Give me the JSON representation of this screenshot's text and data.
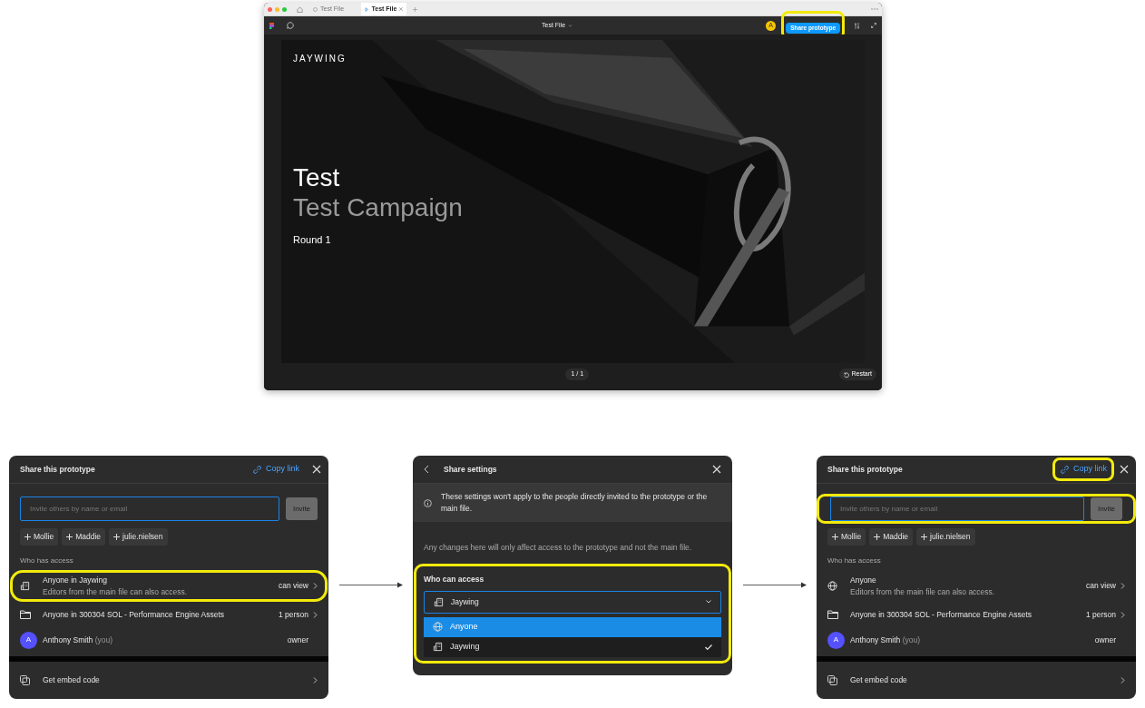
{
  "browser": {
    "tabs": [
      {
        "label": "Test File",
        "kind": "file",
        "selected": false
      },
      {
        "label": "Test File",
        "kind": "prototype",
        "selected": true
      }
    ],
    "toolbar": {
      "file_title": "Test File",
      "avatar": "A",
      "share_button": {
        "label": "Share prototype",
        "highlighted": true
      }
    },
    "slide": {
      "logo": "JAYWING",
      "title": "Test",
      "subtitle": "Test Campaign",
      "round": "Round 1"
    },
    "page_counter": "1 / 1",
    "restart": "Restart"
  },
  "panels": [
    {
      "kind": "share",
      "title": "Share this prototype",
      "copy_link": {
        "label": "Copy link",
        "highlighted": false
      },
      "invite": {
        "placeholder": "Invite others by name or email",
        "button": "Invite",
        "highlighted": false
      },
      "suggestions": [
        "Mollie",
        "Maddie",
        "julie.nielsen"
      ],
      "section": "Who has access",
      "access": [
        {
          "kind": "org",
          "title": "Anyone in Jaywing",
          "subtitle": "Editors from the main file can also access.",
          "value": "can view",
          "chevron": true,
          "highlighted": true
        },
        {
          "kind": "folder",
          "title": "Anyone in 300304 SOL - Performance Engine Assets",
          "value": "1 person",
          "chevron": true,
          "highlighted": false
        },
        {
          "kind": "avatar",
          "avatar": "A",
          "title": "Anthony Smith",
          "note": "(you)",
          "value": "owner",
          "chevron": false,
          "highlighted": false
        }
      ],
      "embed": "Get embed code"
    },
    {
      "kind": "settings",
      "title": "Share settings",
      "notice": "These settings won't apply to the people directly invited to the prototype or the main file.",
      "description": "Any changes here will only affect access to the prototype and not the main file.",
      "access": {
        "label": "Who can access",
        "highlighted": true,
        "value": "Jaywing",
        "options": [
          {
            "kind": "globe",
            "label": "Anyone",
            "hovered": true,
            "selected": false
          },
          {
            "kind": "org",
            "label": "Jaywing",
            "hovered": false,
            "selected": true
          }
        ]
      }
    },
    {
      "kind": "share",
      "title": "Share this prototype",
      "copy_link": {
        "label": "Copy link",
        "highlighted": true
      },
      "invite": {
        "placeholder": "Invite others by name or email",
        "button": "Invite",
        "highlighted": true
      },
      "suggestions": [
        "Mollie",
        "Maddie",
        "julie.nielsen"
      ],
      "section": "Who has access",
      "access": [
        {
          "kind": "globe",
          "title": "Anyone",
          "subtitle": "Editors from the main file can also access.",
          "value": "can view",
          "chevron": true,
          "highlighted": false
        },
        {
          "kind": "folder",
          "title": "Anyone in 300304 SOL - Performance Engine Assets",
          "value": "1 person",
          "chevron": true,
          "highlighted": false
        },
        {
          "kind": "avatar",
          "avatar": "A",
          "title": "Anthony Smith",
          "note": "(you)",
          "value": "owner",
          "chevron": false,
          "highlighted": false
        }
      ],
      "embed": "Get embed code"
    }
  ]
}
